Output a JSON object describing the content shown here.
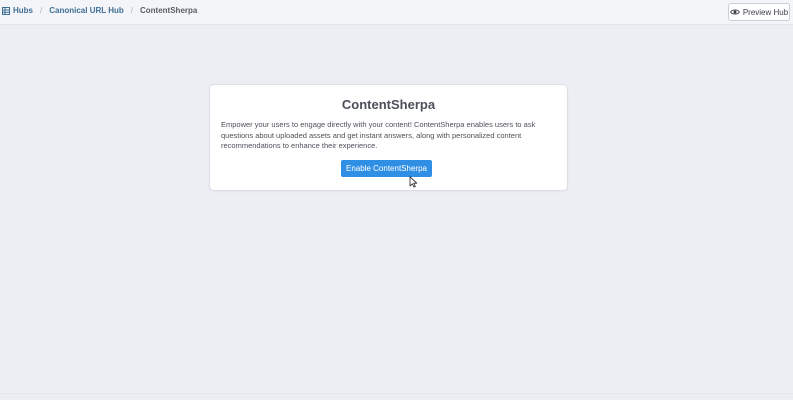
{
  "breadcrumb": {
    "items": [
      {
        "label": "Hubs",
        "icon": "grid-icon"
      },
      {
        "label": "Canonical URL Hub"
      },
      {
        "label": "ContentSherpa"
      }
    ],
    "separator": "/"
  },
  "header": {
    "preview_label": "Preview Hub",
    "preview_icon": "eye-icon"
  },
  "card": {
    "title": "ContentSherpa",
    "description": "Empower your users to engage directly with your content! ContentSherpa enables users to ask questions about uploaded assets and get instant answers, along with personalized content recommendations to enhance their experience.",
    "button_label": "Enable ContentSherpa"
  },
  "colors": {
    "accent": "#2f8fe5",
    "link": "#3f6f94",
    "background": "#eceef4"
  }
}
